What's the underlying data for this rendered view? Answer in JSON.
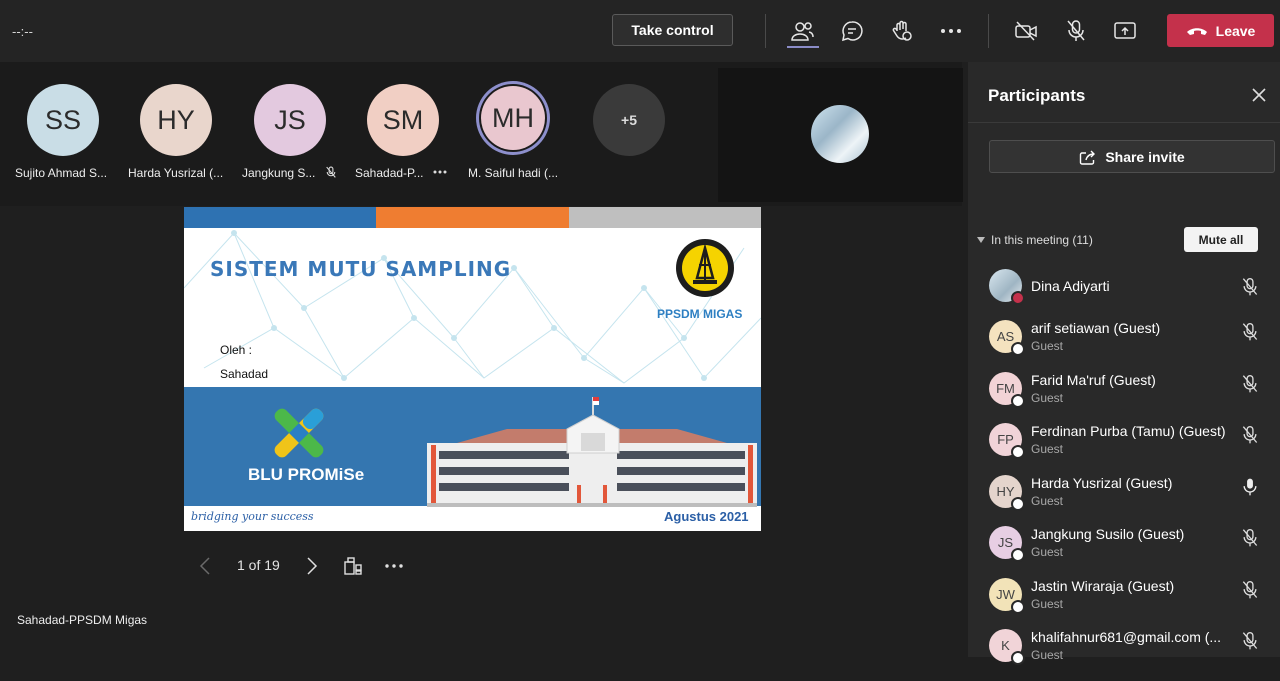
{
  "topbar": {
    "timer": "--:--",
    "take_control_label": "Take control",
    "leave_label": "Leave",
    "colors": {
      "leave": "#c4314b",
      "active_underline": "#8b8cc7"
    }
  },
  "gallery": {
    "participants": [
      {
        "initials": "SS",
        "name": "Sujito Ahmad S...",
        "color": "#c9dde6"
      },
      {
        "initials": "HY",
        "name": "Harda Yusrizal (...",
        "color": "#e9d6cc"
      },
      {
        "initials": "JS",
        "name": "Jangkung S...",
        "color": "#e3c9df"
      },
      {
        "initials": "SM",
        "name": "Sahadad-P...",
        "color": "#f1cfc4"
      },
      {
        "initials": "MH",
        "name": "M. Saiful hadi (...",
        "color": "#e9c7cf"
      }
    ],
    "overflow": "+5"
  },
  "slide": {
    "title": "SISTEM MUTU SAMPLING",
    "org": "PPSDM MIGAS",
    "oleh": "Oleh :",
    "author": "Sahadad",
    "brand": "BLU PROMiSe",
    "tagline": "bridging your success",
    "date": "Agustus 2021"
  },
  "pager": {
    "page": "1 of 19"
  },
  "presenter": "Sahadad-PPSDM Migas",
  "panel": {
    "title": "Participants",
    "share_label": "Share invite",
    "meeting_label": "In this meeting (11)",
    "mute_all_label": "Mute all",
    "people": [
      {
        "initials": "",
        "name": "Dina Adiyarti",
        "sub": "",
        "mic": "muted",
        "color": "#b9cbd6"
      },
      {
        "initials": "AS",
        "name": "arif setiawan (Guest)",
        "sub": "Guest",
        "mic": "muted",
        "color": "#f4e2bf"
      },
      {
        "initials": "FM",
        "name": "Farid Ma'ruf (Guest)",
        "sub": "Guest",
        "mic": "muted",
        "color": "#f2d3d6"
      },
      {
        "initials": "FP",
        "name": "Ferdinan Purba (Tamu) (Guest)",
        "sub": "Guest",
        "mic": "muted",
        "color": "#f0d3d8"
      },
      {
        "initials": "HY",
        "name": "Harda Yusrizal (Guest)",
        "sub": "Guest",
        "mic": "on",
        "color": "#e4d4cc"
      },
      {
        "initials": "JS",
        "name": "Jangkung Susilo (Guest)",
        "sub": "Guest",
        "mic": "muted",
        "color": "#e7cee3"
      },
      {
        "initials": "JW",
        "name": "Jastin Wiraraja (Guest)",
        "sub": "Guest",
        "mic": "muted",
        "color": "#f2e3b8"
      },
      {
        "initials": "K",
        "name": "khalifahnur681@gmail.com (...",
        "sub": "Guest",
        "mic": "muted",
        "color": "#f1d4d8"
      }
    ]
  }
}
